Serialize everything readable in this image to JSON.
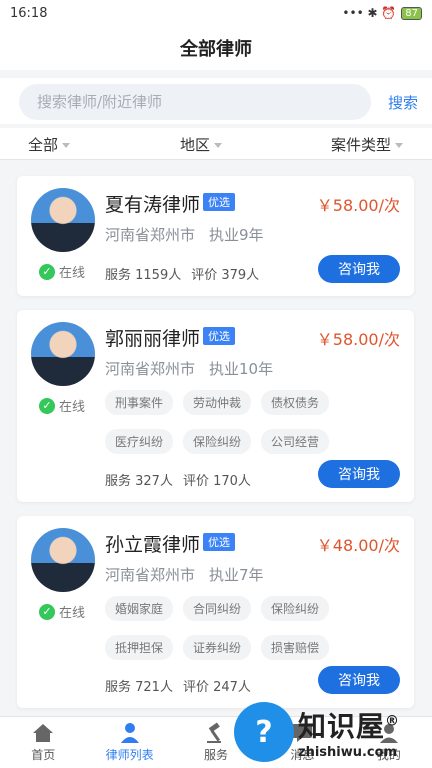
{
  "status_bar": {
    "time": "16:18",
    "icons": "••• ✱ ⏰",
    "battery": "87"
  },
  "header": {
    "title": "全部律师"
  },
  "search": {
    "placeholder": "搜索律师/附近律师",
    "button_label": "搜索"
  },
  "filters": [
    {
      "label": "全部"
    },
    {
      "label": "地区"
    },
    {
      "label": "案件类型"
    }
  ],
  "lawyers": [
    {
      "name": "夏有涛律师",
      "badge": "优选",
      "price": "￥58.00/次",
      "location": "河南省郑州市",
      "experience": "执业9年",
      "online": "在线",
      "service": "服务 1159人",
      "rating": "评价 379人",
      "tags": [],
      "button_label": "咨询我"
    },
    {
      "name": "郭丽丽律师",
      "badge": "优选",
      "price": "￥58.00/次",
      "location": "河南省郑州市",
      "experience": "执业10年",
      "online": "在线",
      "service": "服务 327人",
      "rating": "评价 170人",
      "tags": [
        "刑事案件",
        "劳动仲裁",
        "债权债务",
        "医疗纠纷",
        "保险纠纷",
        "公司经营"
      ],
      "button_label": "咨询我"
    },
    {
      "name": "孙立霞律师",
      "badge": "优选",
      "price": "￥48.00/次",
      "location": "河南省郑州市",
      "experience": "执业7年",
      "online": "在线",
      "service": "服务 721人",
      "rating": "评价 247人",
      "tags": [
        "婚姻家庭",
        "合同纠纷",
        "保险纠纷",
        "抵押担保",
        "证券纠纷",
        "损害赔偿"
      ],
      "button_label": "咨询我"
    }
  ],
  "bottom_nav": [
    {
      "label": "首页",
      "icon": "home-icon"
    },
    {
      "label": "律师列表",
      "icon": "lawyer-icon",
      "active": true
    },
    {
      "label": "服务",
      "icon": "gavel-icon"
    },
    {
      "label": "消息",
      "icon": "message-icon"
    },
    {
      "label": "我的",
      "icon": "profile-icon"
    }
  ],
  "watermark": {
    "title": "知识屋",
    "mark": "®",
    "url": "zhishiwu.com",
    "icon": "question-icon"
  },
  "colors": {
    "accent": "#1e6fe0",
    "price": "#e0552d",
    "online": "#34c759"
  }
}
